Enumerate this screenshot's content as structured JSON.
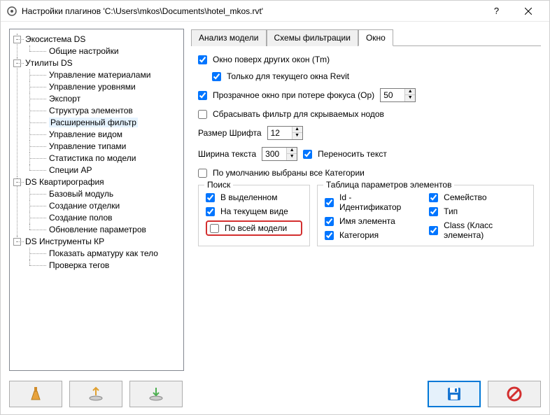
{
  "window": {
    "title": "Настройки плагинов 'C:\\Users\\mkos\\Documents\\hotel_mkos.rvt'"
  },
  "tree": [
    {
      "label": "Экосистема DS",
      "children": [
        "Общие настройки"
      ]
    },
    {
      "label": "Утилиты DS",
      "children": [
        "Управление материалами",
        "Управление уровнями",
        "Экспорт",
        "Структура элементов",
        "Расширенный фильтр",
        "Управление видом",
        "Управление типами",
        "Статистика по модели",
        "Специи АР"
      ]
    },
    {
      "label": "DS Квартирография",
      "children": [
        "Базовый модуль",
        "Создание отделки",
        "Создание полов",
        "Обновление параметров"
      ]
    },
    {
      "label": "DS Инструменты КР",
      "children": [
        "Показать арматуру как тело",
        "Проверка тегов"
      ]
    }
  ],
  "tabs": [
    "Анализ модели",
    "Схемы фильтрации",
    "Окно"
  ],
  "opts": {
    "topmost": "Окно поверх других окон (Tm)",
    "only_current": "Только для текущего окна Revit",
    "transparent": "Прозрачное окно при потере фокуса (Op)",
    "opacity": "50",
    "reset_filter": "Сбрасывать фильтр для скрываемых нодов",
    "font_size_label": "Размер Шрифта",
    "font_size": "12",
    "text_width_label": "Ширина текста",
    "text_width": "300",
    "wrap_text": "Переносить текст",
    "default_all_cat": "По умолчанию выбраны все Категории"
  },
  "search": {
    "legend": "Поиск",
    "items": [
      "В выделенном",
      "На текущем виде",
      "По всей модели"
    ]
  },
  "table": {
    "legend": "Таблица параметров элементов",
    "col1": [
      "Id - Идентификатор",
      "Имя элемента",
      "Категория"
    ],
    "col2": [
      "Семейство",
      "Тип",
      "Class (Класс элемента)"
    ]
  }
}
